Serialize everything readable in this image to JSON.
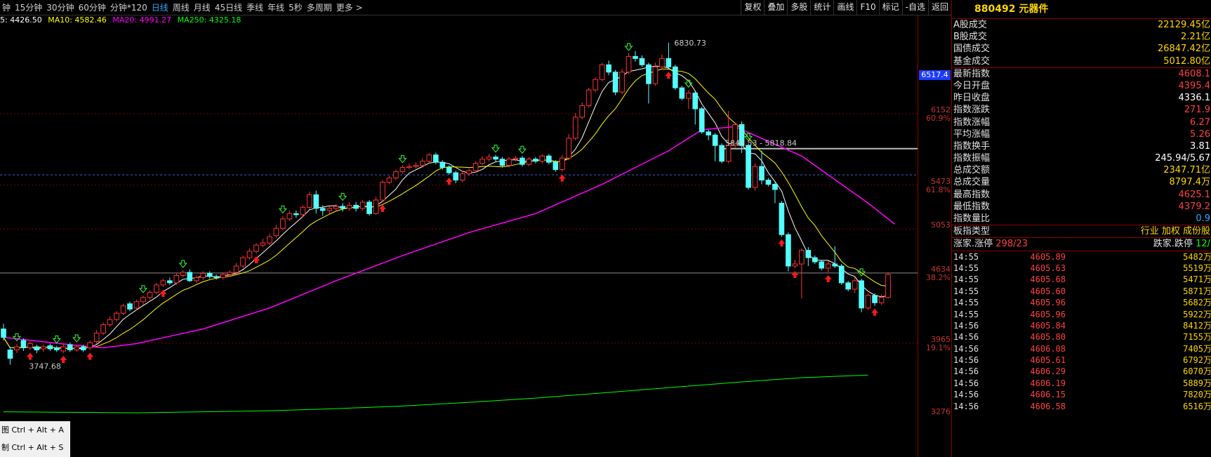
{
  "toolbar": {
    "periods": [
      "钟",
      "15分钟",
      "30分钟",
      "60分钟",
      "分钟*120",
      "日线",
      "周线",
      "月线",
      "45日线",
      "季线",
      "年线",
      "5秒",
      "多周期",
      "更多 >"
    ],
    "active": "日线",
    "right_buttons": [
      "复权",
      "叠加",
      "多股",
      "统计",
      "画线",
      "F10",
      "标记",
      "-自选",
      "返回"
    ]
  },
  "legend": {
    "ma5": "5: 4426.50",
    "ma10": "MA10: 4582.46",
    "ma20": "MA20: 4991.27",
    "ma250": "MA250: 4325.18",
    "colors": {
      "ma5": "#ffffff",
      "ma10": "#ffff00",
      "ma20": "#ff00ff",
      "ma250": "#00ff00",
      "up": "#ff3232",
      "down": "#54ffff"
    }
  },
  "chart_data": {
    "type": "candlestick",
    "annotations": {
      "high_label": "6830.73",
      "low_label": "3747.68",
      "range_label": "5843.53 - 5818.84",
      "current_price_tag": "6517.4"
    },
    "axis_labels": [
      {
        "price": "6152",
        "pct": "60.9%"
      },
      {
        "price": "5473",
        "pct": "61.8%"
      },
      {
        "price": "5053",
        "pct": ""
      },
      {
        "price": "4634",
        "pct": "38.2%"
      },
      {
        "price": "3965",
        "pct": "19.1%"
      },
      {
        "price": "3276",
        "pct": ""
      }
    ],
    "candles": [
      [
        4100,
        4020,
        4150,
        3990
      ],
      [
        3900,
        3820,
        3930,
        3760
      ],
      [
        3900,
        3930,
        3960,
        3870
      ],
      [
        3990,
        3920,
        4010,
        3890
      ],
      [
        3920,
        3960,
        3980,
        3900
      ],
      [
        3930,
        3900,
        3950,
        3870
      ],
      [
        3910,
        3930,
        3950,
        3880
      ],
      [
        3940,
        3910,
        3960,
        3890
      ],
      [
        3920,
        3900,
        3940,
        3880
      ],
      [
        3890,
        3930,
        3960,
        3870
      ],
      [
        3950,
        3900,
        3970,
        3880
      ],
      [
        3900,
        3930,
        3950,
        3880
      ],
      [
        3930,
        3900,
        3950,
        3880
      ],
      [
        3920,
        3970,
        3990,
        3900
      ],
      [
        3980,
        4060,
        4090,
        3960
      ],
      [
        4060,
        4140,
        4160,
        4040
      ],
      [
        4140,
        4190,
        4220,
        4120
      ],
      [
        4190,
        4250,
        4270,
        4170
      ],
      [
        4250,
        4320,
        4340,
        4230
      ],
      [
        4340,
        4290,
        4360,
        4270
      ],
      [
        4300,
        4360,
        4380,
        4280
      ],
      [
        4360,
        4400,
        4420,
        4330
      ],
      [
        4400,
        4450,
        4470,
        4380
      ],
      [
        4450,
        4520,
        4540,
        4430
      ],
      [
        4520,
        4560,
        4580,
        4500
      ],
      [
        4560,
        4540,
        4590,
        4520
      ],
      [
        4540,
        4610,
        4630,
        4520
      ],
      [
        4610,
        4640,
        4660,
        4590
      ],
      [
        4640,
        4560,
        4670,
        4550
      ],
      [
        4560,
        4590,
        4610,
        4540
      ],
      [
        4590,
        4630,
        4650,
        4570
      ],
      [
        4630,
        4600,
        4650,
        4580
      ],
      [
        4600,
        4590,
        4620,
        4570
      ],
      [
        4590,
        4620,
        4640,
        4570
      ],
      [
        4620,
        4640,
        4660,
        4600
      ],
      [
        4640,
        4700,
        4730,
        4620
      ],
      [
        4700,
        4780,
        4800,
        4680
      ],
      [
        4780,
        4840,
        4870,
        4760
      ],
      [
        4840,
        4900,
        4920,
        4820
      ],
      [
        4900,
        4920,
        4960,
        4880
      ],
      [
        4920,
        4980,
        5010,
        4900
      ],
      [
        4990,
        5060,
        5090,
        4970
      ],
      [
        5060,
        5150,
        5180,
        5040
      ],
      [
        5150,
        5200,
        5230,
        5130
      ],
      [
        5200,
        5190,
        5230,
        5160
      ],
      [
        5190,
        5260,
        5280,
        5170
      ],
      [
        5260,
        5380,
        5410,
        5240
      ],
      [
        5380,
        5250,
        5420,
        5200
      ],
      [
        5250,
        5230,
        5280,
        5180
      ],
      [
        5230,
        5250,
        5270,
        5200
      ],
      [
        5250,
        5270,
        5290,
        5230
      ],
      [
        5270,
        5250,
        5300,
        5220
      ],
      [
        5250,
        5280,
        5310,
        5230
      ],
      [
        5280,
        5250,
        5310,
        5220
      ],
      [
        5250,
        5310,
        5330,
        5230
      ],
      [
        5310,
        5200,
        5330,
        5180
      ],
      [
        5200,
        5330,
        5360,
        5190
      ],
      [
        5330,
        5500,
        5520,
        5310
      ],
      [
        5500,
        5540,
        5560,
        5480
      ],
      [
        5540,
        5600,
        5620,
        5520
      ],
      [
        5600,
        5640,
        5660,
        5580
      ],
      [
        5640,
        5650,
        5680,
        5620
      ],
      [
        5650,
        5660,
        5690,
        5630
      ],
      [
        5660,
        5700,
        5730,
        5640
      ],
      [
        5700,
        5760,
        5780,
        5680
      ],
      [
        5760,
        5690,
        5780,
        5670
      ],
      [
        5690,
        5640,
        5710,
        5620
      ],
      [
        5640,
        5590,
        5660,
        5570
      ],
      [
        5590,
        5520,
        5610,
        5490
      ],
      [
        5520,
        5580,
        5610,
        5500
      ],
      [
        5580,
        5610,
        5640,
        5560
      ],
      [
        5610,
        5680,
        5700,
        5590
      ],
      [
        5680,
        5720,
        5750,
        5660
      ],
      [
        5720,
        5740,
        5770,
        5700
      ],
      [
        5740,
        5720,
        5760,
        5690
      ],
      [
        5720,
        5660,
        5740,
        5640
      ],
      [
        5660,
        5720,
        5740,
        5640
      ],
      [
        5720,
        5730,
        5750,
        5700
      ],
      [
        5730,
        5670,
        5750,
        5650
      ],
      [
        5670,
        5720,
        5740,
        5650
      ],
      [
        5720,
        5700,
        5740,
        5680
      ],
      [
        5700,
        5750,
        5770,
        5680
      ],
      [
        5750,
        5690,
        5770,
        5670
      ],
      [
        5690,
        5620,
        5710,
        5600
      ],
      [
        5620,
        5730,
        5760,
        5600
      ],
      [
        5730,
        5920,
        5960,
        5710
      ],
      [
        5920,
        6120,
        6160,
        5900
      ],
      [
        6120,
        6230,
        6260,
        6100
      ],
      [
        6230,
        6380,
        6400,
        6210
      ],
      [
        6380,
        6480,
        6500,
        6360
      ],
      [
        6480,
        6620,
        6640,
        6460
      ],
      [
        6620,
        6550,
        6660,
        6520
      ],
      [
        6550,
        6360,
        6570,
        6330
      ],
      [
        6360,
        6550,
        6580,
        6340
      ],
      [
        6550,
        6700,
        6730,
        6530
      ],
      [
        6700,
        6680,
        6750,
        6650
      ],
      [
        6680,
        6620,
        6710,
        6600
      ],
      [
        6620,
        6440,
        6640,
        6250
      ],
      [
        6440,
        6600,
        6640,
        6420
      ],
      [
        6600,
        6680,
        6720,
        6570
      ],
      [
        6680,
        6600,
        6830,
        6580
      ],
      [
        6600,
        6400,
        6620,
        6380
      ],
      [
        6400,
        6300,
        6420,
        6280
      ],
      [
        6300,
        6350,
        6380,
        6200
      ],
      [
        6350,
        6200,
        6370,
        6050
      ],
      [
        6200,
        5980,
        6220,
        5960
      ],
      [
        5980,
        5950,
        6000,
        5900
      ],
      [
        5950,
        5850,
        5970,
        5700
      ],
      [
        5850,
        5700,
        5870,
        5680
      ],
      [
        5700,
        5850,
        6180,
        5680
      ],
      [
        5850,
        6050,
        6070,
        5830
      ],
      [
        6050,
        5850,
        6080,
        5780
      ],
      [
        5850,
        5450,
        5870,
        5430
      ],
      [
        5450,
        5650,
        5680,
        5420
      ],
      [
        5650,
        5520,
        5800,
        5480
      ],
      [
        5520,
        5480,
        5540,
        5460
      ],
      [
        5480,
        5430,
        5500,
        5300
      ],
      [
        5300,
        5000,
        5320,
        4980
      ],
      [
        5000,
        4700,
        5020,
        4650
      ],
      [
        4700,
        4720,
        4760,
        4680
      ],
      [
        4720,
        4850,
        4870,
        4390
      ],
      [
        4850,
        4780,
        4880,
        4700
      ],
      [
        4780,
        4740,
        4800,
        4720
      ],
      [
        4740,
        4680,
        4760,
        4660
      ],
      [
        4680,
        4720,
        4750,
        4640
      ],
      [
        4720,
        4700,
        4890,
        4680
      ],
      [
        4700,
        4540,
        4720,
        4520
      ],
      [
        4540,
        4480,
        4560,
        4460
      ],
      [
        4480,
        4560,
        4600,
        4440
      ],
      [
        4560,
        4300,
        4580,
        4260
      ],
      [
        4300,
        4420,
        4440,
        4280
      ],
      [
        4420,
        4350,
        4440,
        4320
      ],
      [
        4350,
        4400,
        4430,
        4330
      ],
      [
        4400,
        4620,
        4640,
        4390
      ]
    ],
    "ma250": [
      [
        0,
        3310
      ],
      [
        10,
        3305
      ],
      [
        20,
        3300
      ],
      [
        30,
        3310
      ],
      [
        40,
        3320
      ],
      [
        50,
        3340
      ],
      [
        60,
        3365
      ],
      [
        70,
        3400
      ],
      [
        80,
        3440
      ],
      [
        90,
        3490
      ],
      [
        100,
        3540
      ],
      [
        110,
        3590
      ],
      [
        120,
        3635
      ],
      [
        130,
        3660
      ]
    ],
    "ma20": [
      [
        0,
        4020
      ],
      [
        10,
        3950
      ],
      [
        15,
        3920
      ],
      [
        20,
        3960
      ],
      [
        30,
        4100
      ],
      [
        40,
        4300
      ],
      [
        50,
        4560
      ],
      [
        60,
        4800
      ],
      [
        70,
        5020
      ],
      [
        80,
        5200
      ],
      [
        90,
        5480
      ],
      [
        100,
        5800
      ],
      [
        105,
        6000
      ],
      [
        110,
        6030
      ],
      [
        120,
        5750
      ],
      [
        130,
        5300
      ],
      [
        134,
        5100
      ]
    ]
  },
  "panel": {
    "code": "880492",
    "name": "元器件",
    "stats": [
      {
        "label": "A股成交",
        "value": "22129.45亿",
        "color": "#ffd700"
      },
      {
        "label": "B股成交",
        "value": "2.21亿",
        "color": "#ffd700"
      },
      {
        "label": "国债成交",
        "value": "26847.42亿",
        "color": "#ffd700"
      },
      {
        "label": "基金成交",
        "value": "5012.80亿",
        "color": "#ffd700"
      }
    ],
    "stats2": [
      {
        "label": "最新指数",
        "value": "4608.1",
        "color": "#ff4040"
      },
      {
        "label": "今日开盘",
        "value": "4395.4",
        "color": "#ff4040"
      },
      {
        "label": "昨日收盘",
        "value": "4336.1",
        "color": "#ffffff"
      },
      {
        "label": "指数涨跌",
        "value": "271.9",
        "color": "#ff4040"
      },
      {
        "label": "指数涨幅",
        "value": "6.27",
        "color": "#ff4040"
      },
      {
        "label": "平均涨幅",
        "value": "5.26",
        "color": "#ff4040"
      },
      {
        "label": "指数换手",
        "value": "3.81",
        "color": "#ffffff"
      },
      {
        "label": "指数振幅",
        "value": "245.94/5.67",
        "color": "#ffffff"
      },
      {
        "label": "总成交额",
        "value": "2347.71亿",
        "color": "#ffd700"
      },
      {
        "label": "总成交量",
        "value": "8797.4万",
        "color": "#ffd700"
      },
      {
        "label": "最高指数",
        "value": "4625.1",
        "color": "#ff4040"
      },
      {
        "label": "最低指数",
        "value": "4379.2",
        "color": "#ff4040"
      },
      {
        "label": "指数量比",
        "value": "0.9",
        "color": "#2fa8ff"
      }
    ],
    "sector_label": "板指类型",
    "sector_value": "行业 加权 成份股",
    "updown_label1": "涨家.涨停",
    "updown_value1": "298/23",
    "updown_label2": "跌家.跌停",
    "updown_value2": "12/",
    "ticks": [
      {
        "t": "14:55",
        "p": "4605.89",
        "v": "5482万"
      },
      {
        "t": "14:55",
        "p": "4605.63",
        "v": "5519万"
      },
      {
        "t": "14:55",
        "p": "4605.68",
        "v": "5471万"
      },
      {
        "t": "14:55",
        "p": "4605.60",
        "v": "5871万"
      },
      {
        "t": "14:55",
        "p": "4605.96",
        "v": "5682万"
      },
      {
        "t": "14:55",
        "p": "4605.96",
        "v": "5922万"
      },
      {
        "t": "14:56",
        "p": "4605.84",
        "v": "8412万"
      },
      {
        "t": "14:56",
        "p": "4605.80",
        "v": "7155万"
      },
      {
        "t": "14:56",
        "p": "4606.08",
        "v": "7405万"
      },
      {
        "t": "14:56",
        "p": "4605.61",
        "v": "6792万"
      },
      {
        "t": "14:56",
        "p": "4606.29",
        "v": "6070万"
      },
      {
        "t": "14:56",
        "p": "4606.19",
        "v": "5889万"
      },
      {
        "t": "14:56",
        "p": "4606.15",
        "v": "7820万"
      },
      {
        "t": "14:56",
        "p": "4606.58",
        "v": "6516万"
      }
    ]
  },
  "context_menu": [
    "图 Ctrl + Alt + A",
    "制 Ctrl + Alt + S"
  ]
}
